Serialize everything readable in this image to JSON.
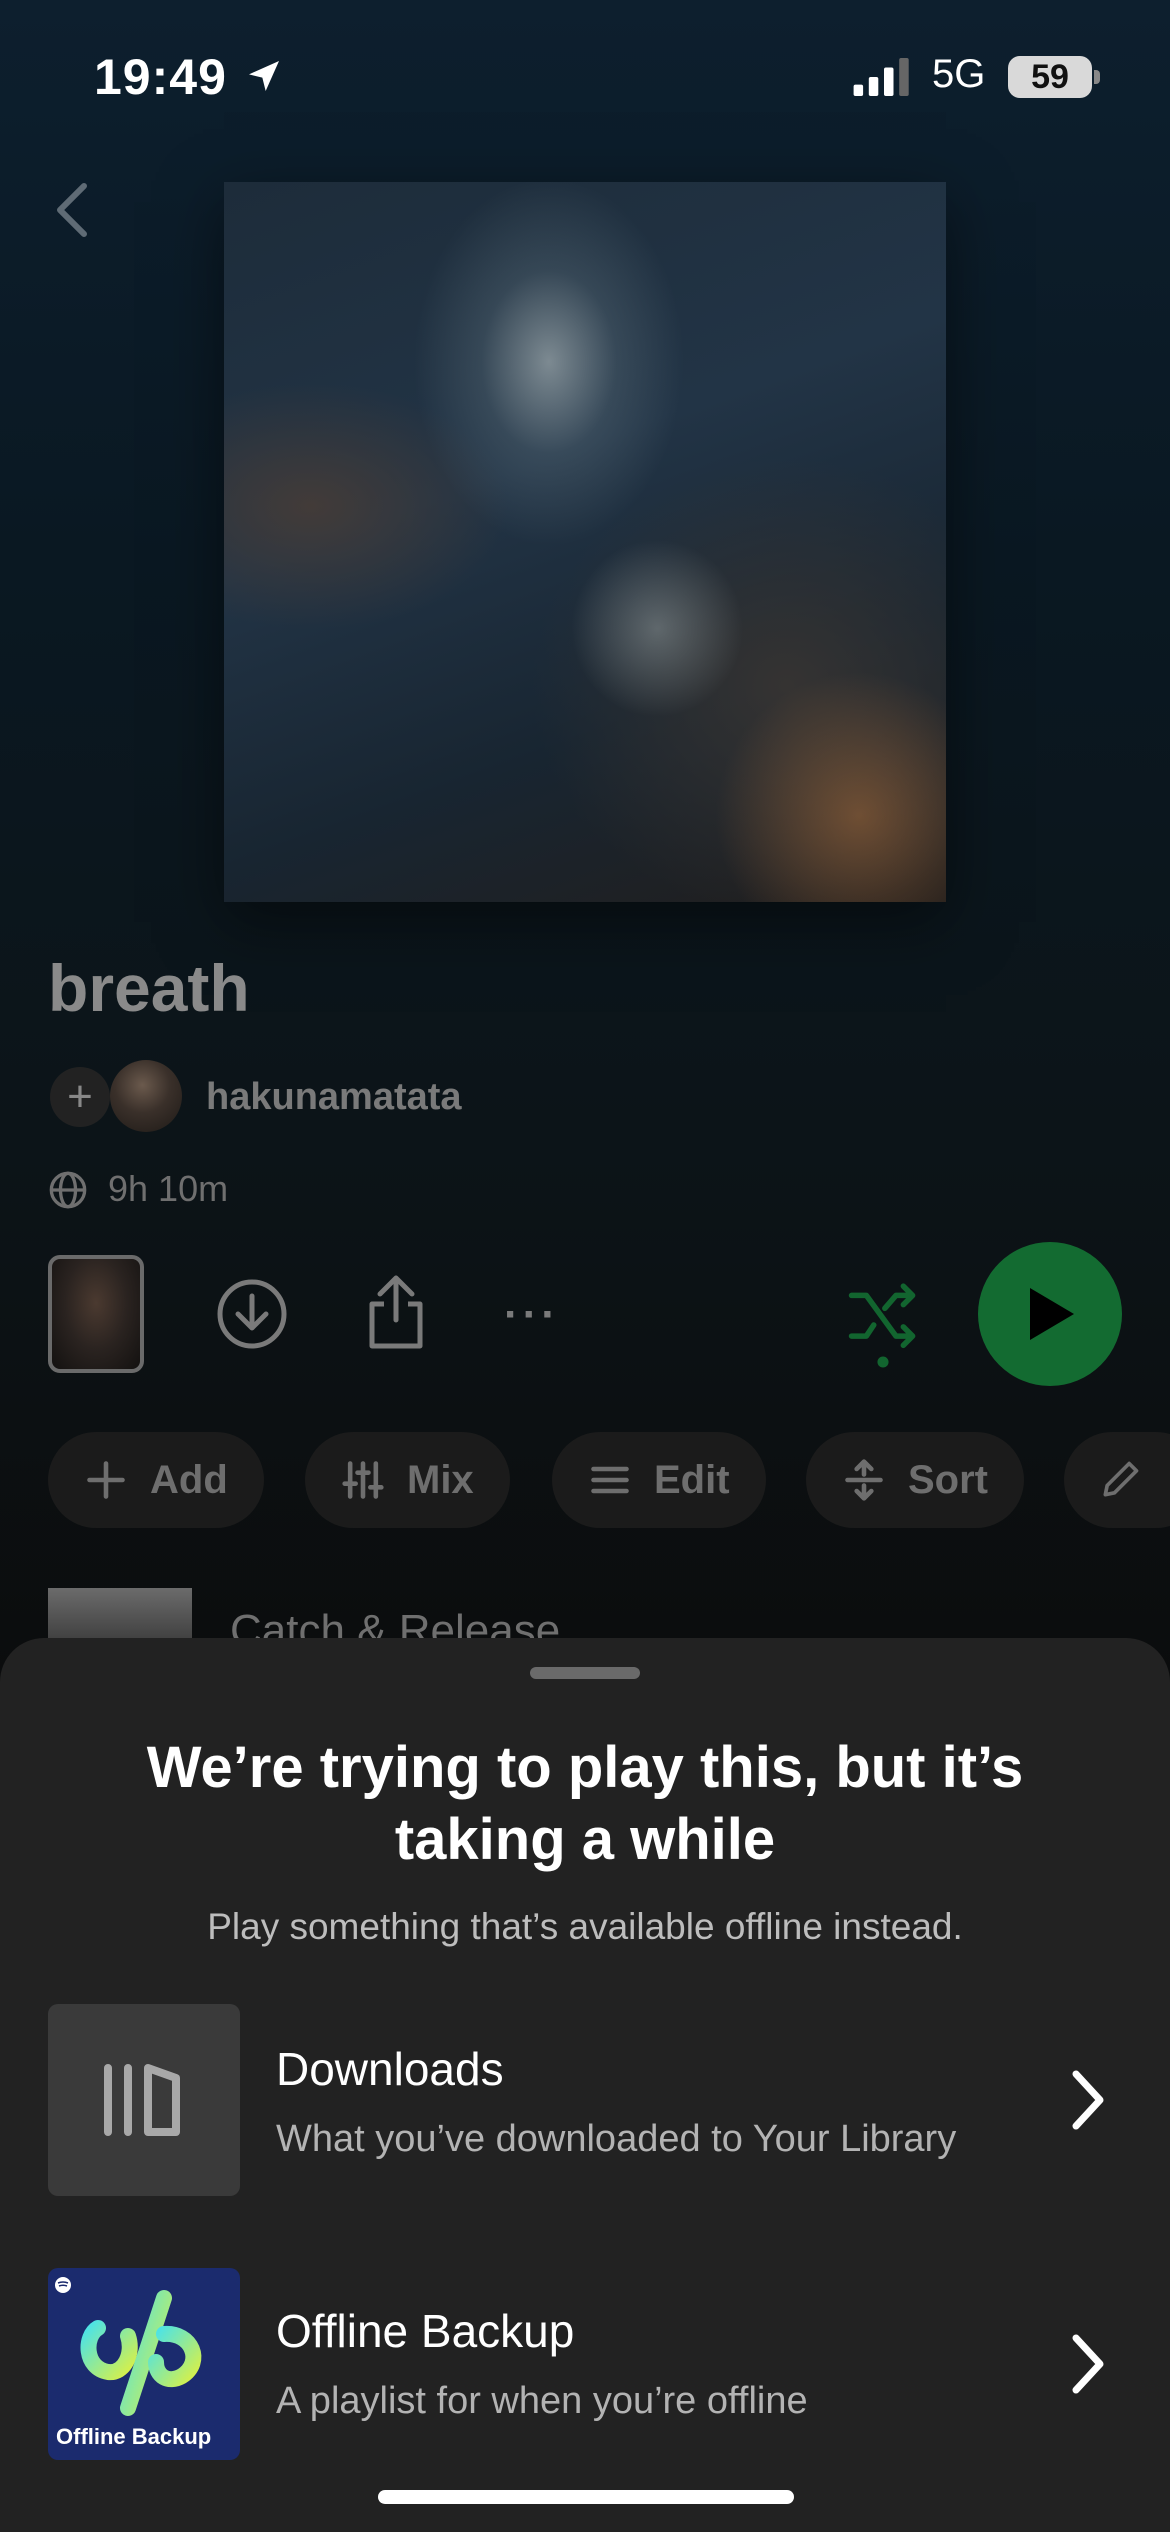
{
  "status_bar": {
    "time": "19:49",
    "network": "5G",
    "battery": "59"
  },
  "playlist": {
    "title": "breath",
    "owner": "hakunamatata",
    "duration": "9h 10m",
    "accent_color": "#1db954"
  },
  "chips": [
    {
      "label": "Add",
      "icon": "plus-icon"
    },
    {
      "label": "Mix",
      "icon": "sliders-icon"
    },
    {
      "label": "Edit",
      "icon": "lines-icon"
    },
    {
      "label": "Sort",
      "icon": "sort-icon"
    }
  ],
  "track": {
    "title": "Catch & Release"
  },
  "sheet": {
    "title": "We’re trying to play this, but it’s taking a while",
    "subtitle": "Play something that’s available offline instead.",
    "options": [
      {
        "title": "Downloads",
        "subtitle": "What you’ve downloaded to Your Library",
        "icon": "downloads-library-icon"
      },
      {
        "title": "Offline Backup",
        "subtitle": "A playlist for when you’re offline",
        "cover_label": "Offline Backup"
      }
    ]
  }
}
